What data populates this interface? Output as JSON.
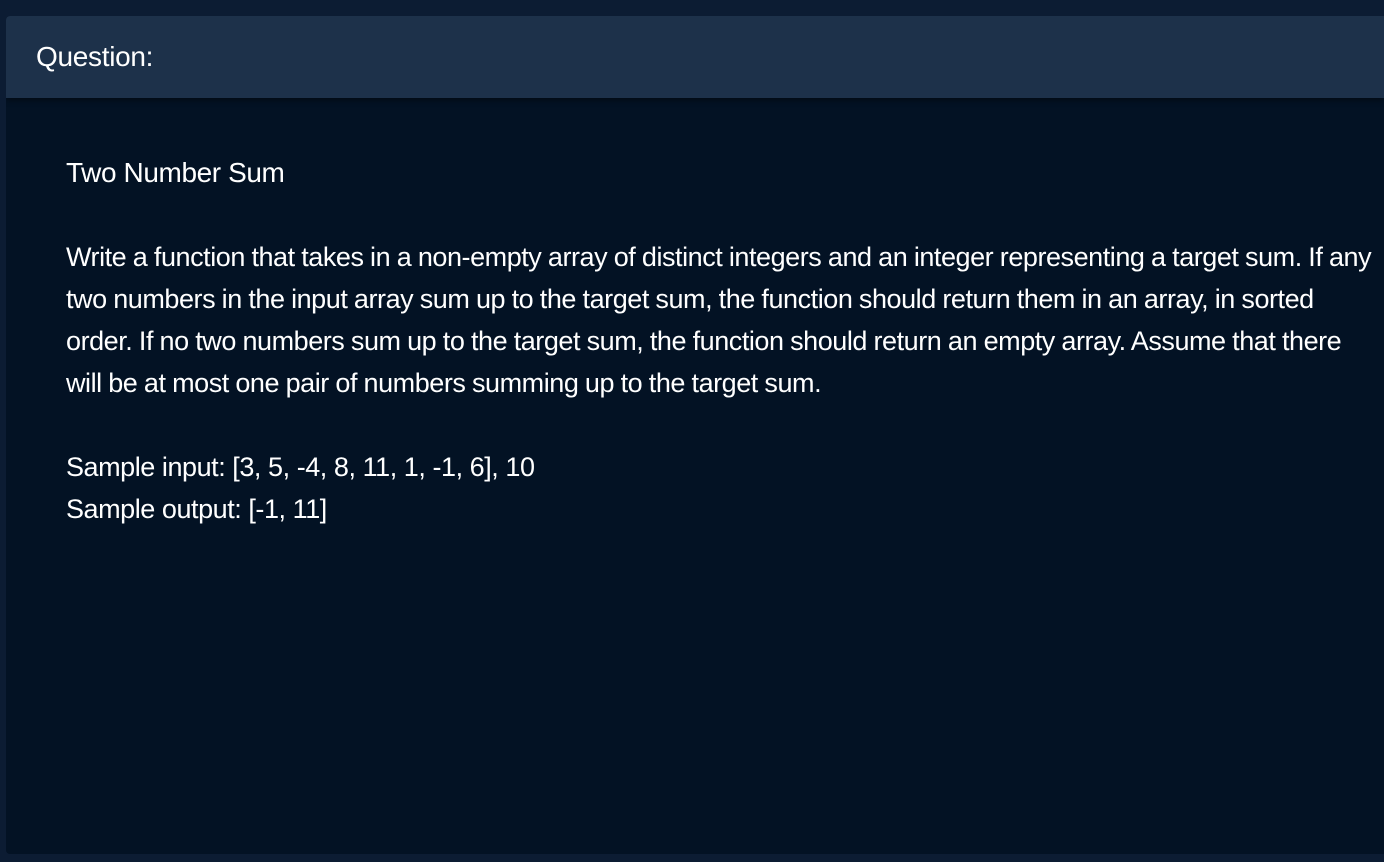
{
  "panel": {
    "header_label": "Question:"
  },
  "question": {
    "title": "Two Number Sum",
    "description": "Write a function that takes in a non-empty array of distinct integers and an integer representing a target sum. If any two numbers in the input array sum up to the target sum, the function should return them in an array, in sorted order. If no two numbers sum up to the target sum, the function should return an empty array. Assume that there will be at most one pair of numbers summing up to the target sum.",
    "sample_input": "Sample input: [3, 5, -4, 8, 11, 1, -1, 6], 10",
    "sample_output": "Sample output: [-1, 11]"
  },
  "colors": {
    "page_background": "#0c1c33",
    "panel_background": "#031224",
    "header_background": "#1d314a",
    "text": "#ffffff"
  }
}
